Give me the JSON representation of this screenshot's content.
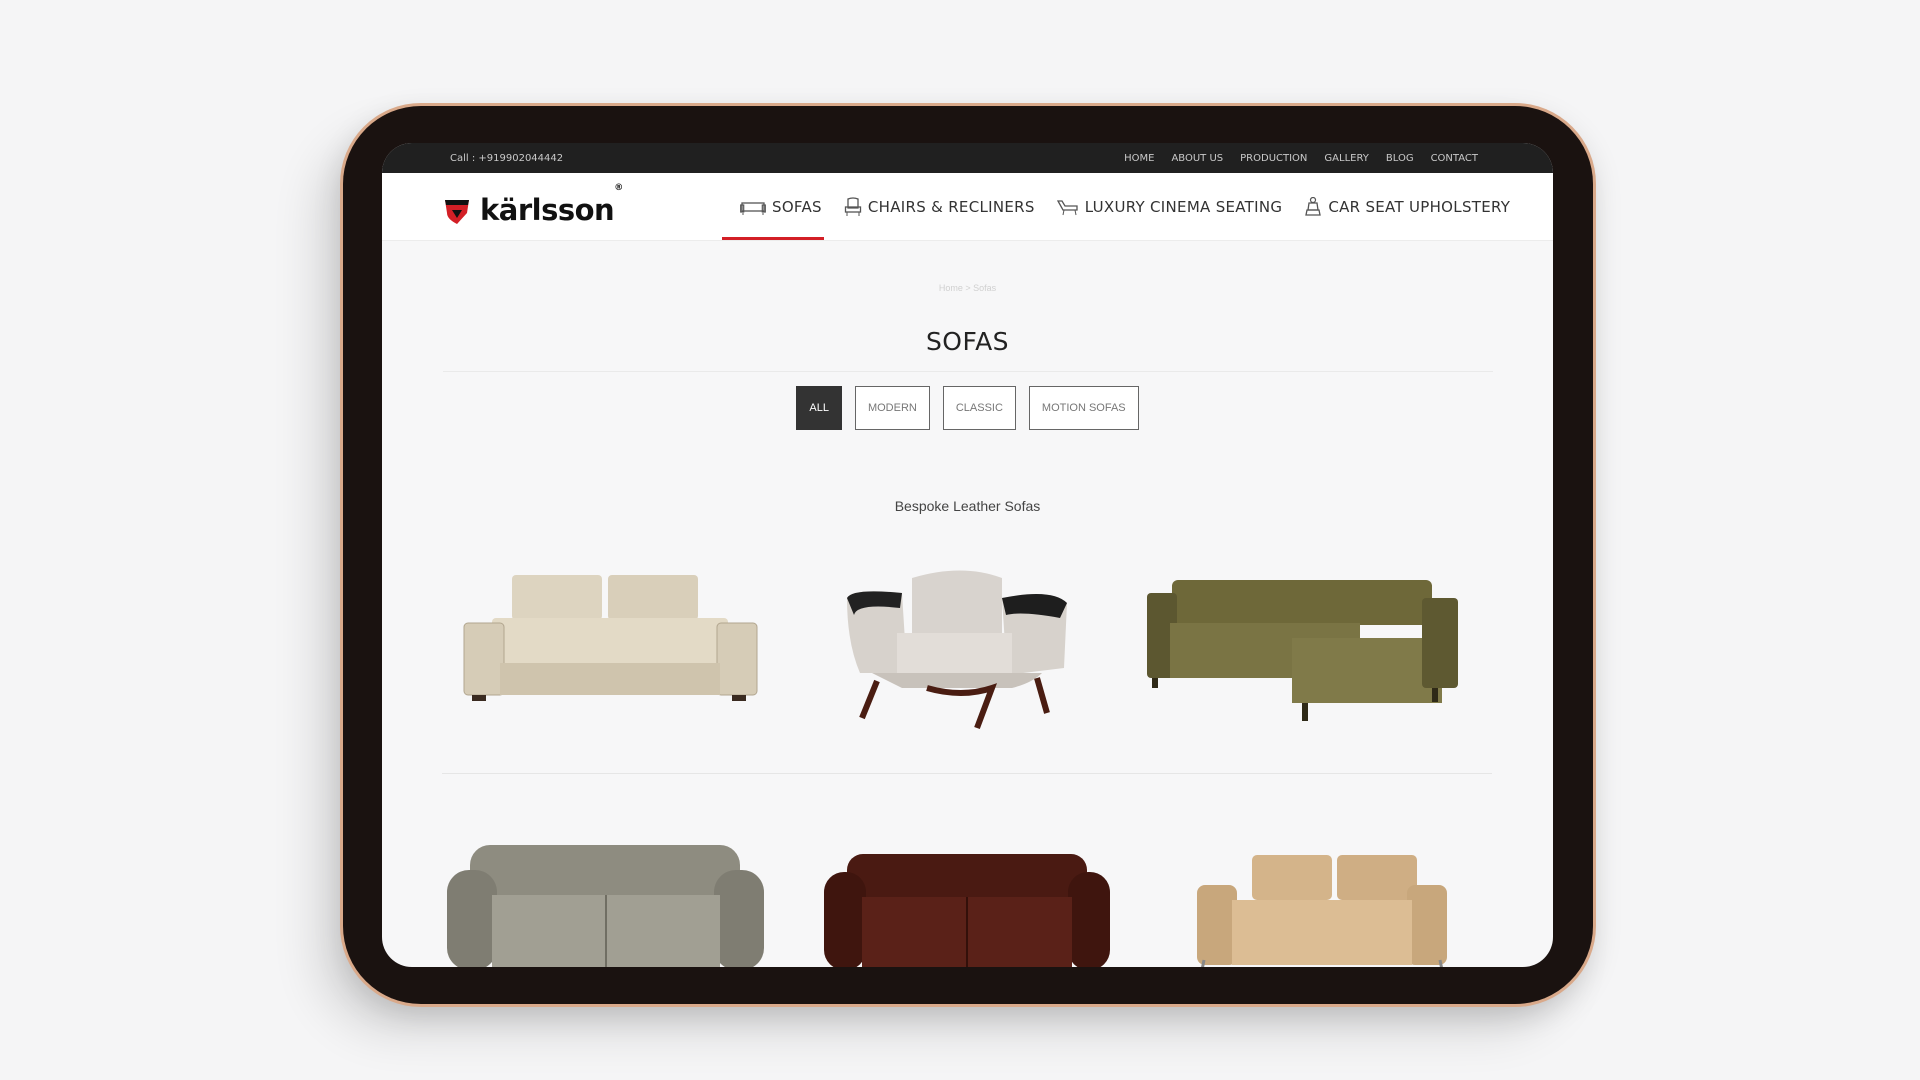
{
  "topbar": {
    "phone": "Call : +919902044442",
    "links": [
      "HOME",
      "ABOUT US",
      "PRODUCTION",
      "GALLERY",
      "BLOG",
      "CONTACT"
    ]
  },
  "brand": {
    "name": "kärlsson",
    "mark": "®"
  },
  "nav": [
    {
      "label": "SOFAS",
      "icon": "sofa-icon",
      "active": true
    },
    {
      "label": "CHAIRS & RECLINERS",
      "icon": "chair-icon"
    },
    {
      "label": "LUXURY CINEMA SEATING",
      "icon": "cinema-seat-icon"
    },
    {
      "label": "CAR SEAT UPHOLSTERY",
      "icon": "car-seat-icon"
    }
  ],
  "breadcrumb": "Home > Sofas",
  "page_title": "SOFAS",
  "filters": [
    {
      "label": "ALL",
      "active": true
    },
    {
      "label": "MODERN"
    },
    {
      "label": "CLASSIC"
    },
    {
      "label": "MOTION SOFAS"
    }
  ],
  "section_title": "Bespoke Leather Sofas",
  "colors": {
    "accent": "#d31f26",
    "topbar": "#202020",
    "active_filter": "#333333"
  }
}
